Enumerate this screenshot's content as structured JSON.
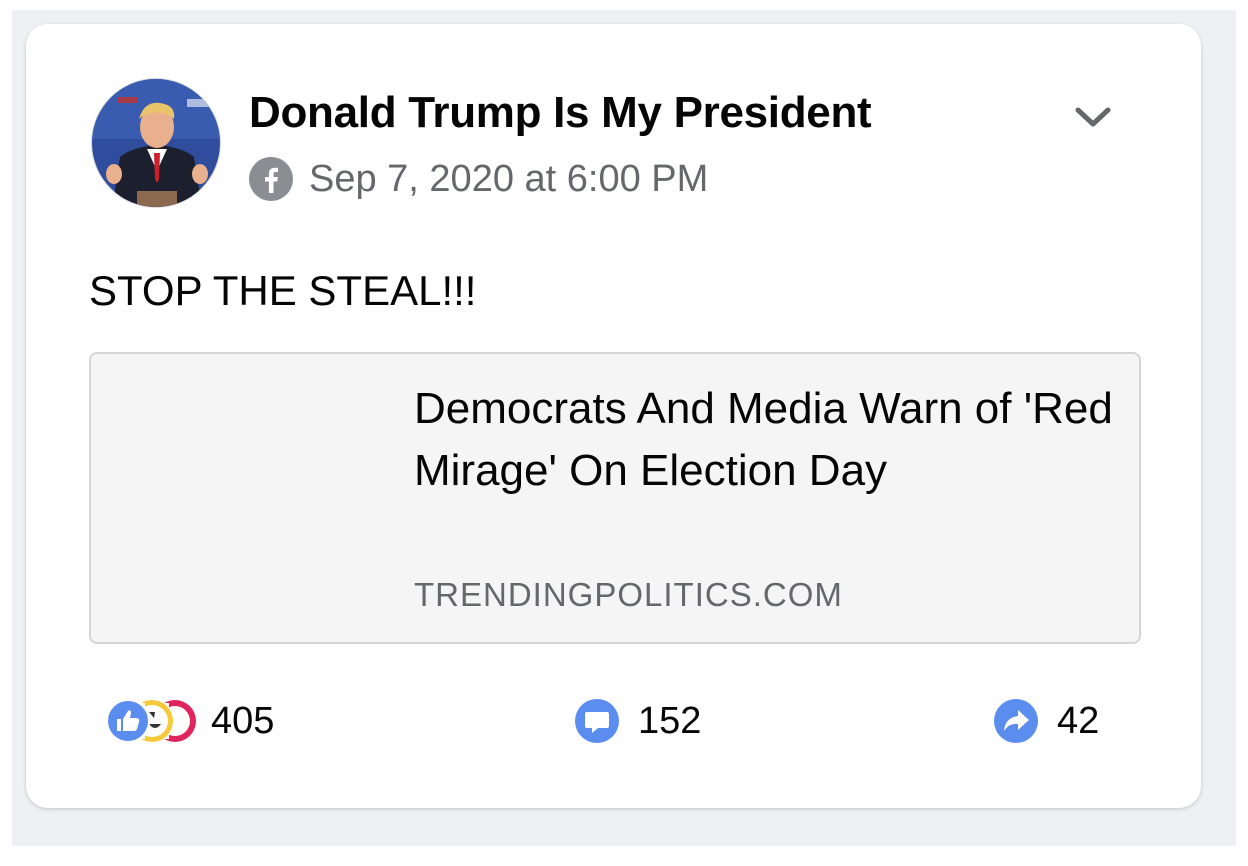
{
  "post": {
    "page_name": "Donald Trump Is My President",
    "timestamp": "Sep 7, 2020 at 6:00 PM",
    "platform_icon": "facebook-icon",
    "menu_icon": "chevron-down-icon",
    "text": "STOP THE STEAL!!!"
  },
  "link_preview": {
    "title": "Democrats And Media Warn of 'Red Mirage' On Election Day",
    "domain": "TRENDINGPOLITICS.COM"
  },
  "stats": {
    "reactions": {
      "icons": [
        "like-icon",
        "haha-icon",
        "angry-icon"
      ],
      "count": "405"
    },
    "comments": {
      "icon": "comment-icon",
      "count": "152"
    },
    "shares": {
      "icon": "share-icon",
      "count": "42"
    }
  },
  "colors": {
    "facebook_blue": "#1877f2",
    "stat_blue": "#5b8def",
    "haha_yellow": "#f6c93b",
    "angry_red": "#e0245e",
    "secondary_text": "#65676b"
  }
}
